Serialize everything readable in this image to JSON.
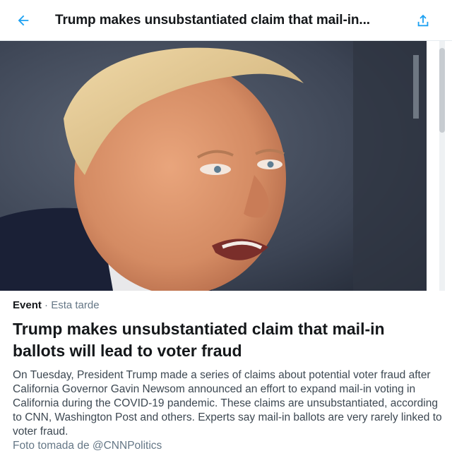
{
  "header": {
    "title": "Trump makes unsubstantiated claim that mail-in...",
    "back_icon": "arrow-left-icon",
    "share_icon": "share-icon",
    "accent_color": "#1da1f2"
  },
  "hero_image": {
    "description_icon": "news-photo"
  },
  "article": {
    "category": "Event",
    "separator": " · ",
    "time": "Esta tarde",
    "headline": "Trump makes unsubstantiated claim that mail-in ballots will lead to voter fraud",
    "summary": "On Tuesday, President Trump made a series of claims about potential voter fraud after California Governor Gavin Newsom announced an effort to expand mail-in voting in California during the COVID-19 pandemic. These claims are unsubstantiated, according to CNN, Washington Post and others. Experts say mail-in ballots are very rarely linked to voter fraud.",
    "credit": "Foto tomada de @CNNPolitics"
  }
}
